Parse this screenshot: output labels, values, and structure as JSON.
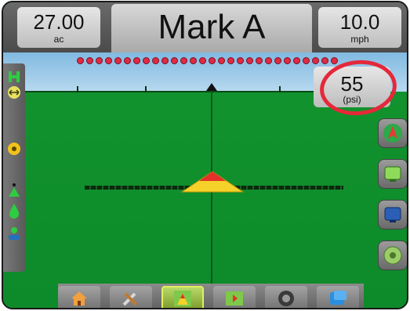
{
  "header": {
    "area_value": "27.00",
    "area_unit": "ac",
    "title": "Mark A",
    "speed_value": "10.0",
    "speed_unit": "mph"
  },
  "pressure": {
    "value": "55",
    "unit": "(psi)"
  },
  "boom_sections": 28,
  "left_toolbar": {
    "icons": [
      "bar-graph-icon",
      "boom-width-icon",
      "hazard-icon",
      "boom-height-icon",
      "droplet-icon",
      "person-icon"
    ]
  },
  "right_toolbar": {
    "buttons": [
      "vehicle-view-icon",
      "map-view-icon",
      "screen-view-icon",
      "nudge-icon"
    ]
  },
  "bottom_nav": {
    "items": [
      "home-icon",
      "tools-icon",
      "guidance-icon",
      "map-icon",
      "camera-icon",
      "data-icon"
    ],
    "active_index": 2
  },
  "colors": {
    "field": "#0d8a2a",
    "sky": "#9fcbeb",
    "highlight": "#e5283a",
    "boom_dot": "#e02a45",
    "vehicle": "#f0c22a"
  }
}
